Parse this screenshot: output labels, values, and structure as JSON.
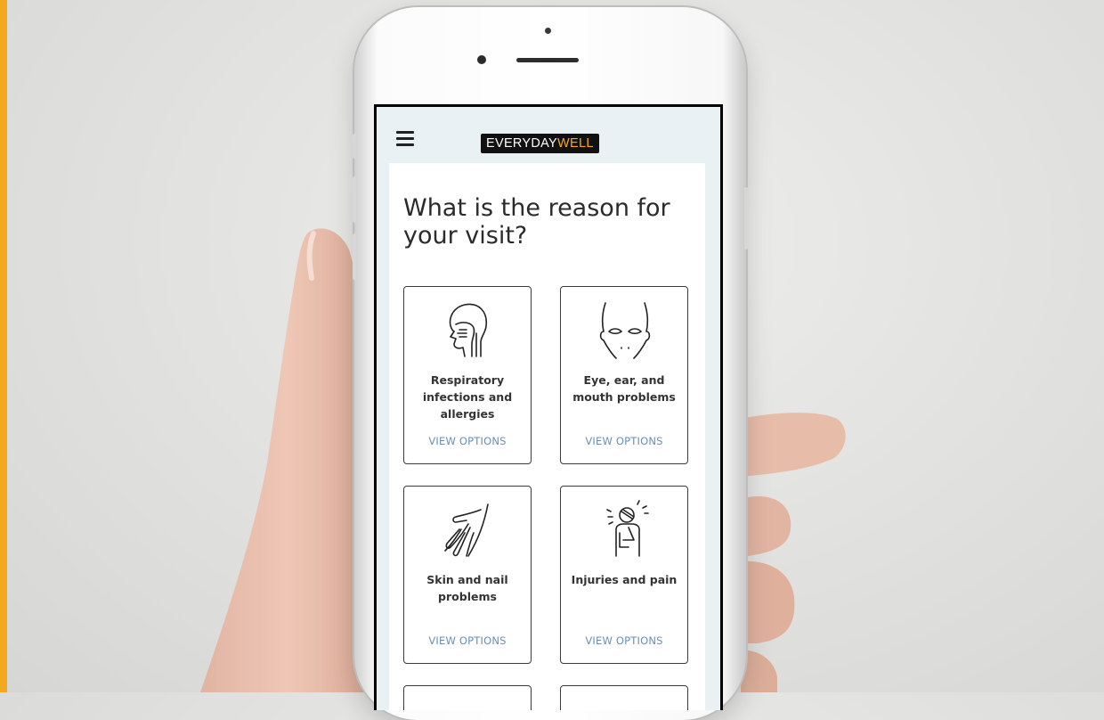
{
  "brand": {
    "logo_part1": "EVERYDAY",
    "logo_part2": "WELL",
    "accent": "#f2a91f",
    "link_color": "#6a8fb3"
  },
  "page": {
    "title": "What is the reason for your visit?"
  },
  "options": [
    {
      "label": "Respiratory infections and allergies",
      "action": "VIEW OPTIONS",
      "icon": "respiratory-head-icon"
    },
    {
      "label": "Eye, ear, and mouth problems",
      "action": "VIEW OPTIONS",
      "icon": "face-icon"
    },
    {
      "label": "Skin and nail problems",
      "action": "VIEW OPTIONS",
      "icon": "hand-icon"
    },
    {
      "label": "Injuries and pain",
      "action": "VIEW OPTIONS",
      "icon": "injured-person-icon"
    }
  ]
}
